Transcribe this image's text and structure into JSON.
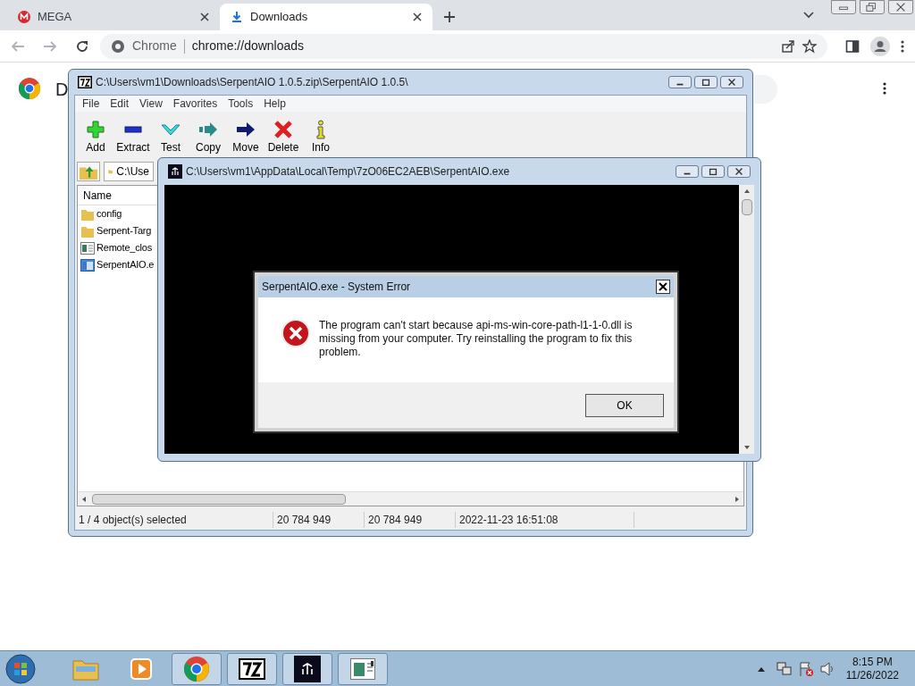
{
  "browser": {
    "tabs": [
      {
        "title": "MEGA",
        "kind": "mega",
        "selected": false
      },
      {
        "title": "Downloads",
        "kind": "download",
        "selected": true
      }
    ],
    "omnibox": {
      "site_label": "Chrome",
      "url": "chrome://downloads"
    },
    "page": {
      "title": "D"
    }
  },
  "archive_window": {
    "title": "C:\\Users\\vm1\\Downloads\\SerpentAIO 1.0.5.zip\\SerpentAIO 1.0.5\\",
    "menu": [
      "File",
      "Edit",
      "View",
      "Favorites",
      "Tools",
      "Help"
    ],
    "toolbar": [
      {
        "label": "Add",
        "kind": "add"
      },
      {
        "label": "Extract",
        "kind": "extract"
      },
      {
        "label": "Test",
        "kind": "test"
      },
      {
        "label": "Copy",
        "kind": "copy"
      },
      {
        "label": "Move",
        "kind": "move"
      },
      {
        "label": "Delete",
        "kind": "delete"
      },
      {
        "label": "Info",
        "kind": "info"
      }
    ],
    "address": "C:\\Use",
    "columns": [
      "Name"
    ],
    "files": [
      {
        "name": "config",
        "kind": "folder"
      },
      {
        "name": "Serpent-Targ",
        "kind": "folder"
      },
      {
        "name": "Remote_clos",
        "kind": "file"
      },
      {
        "name": "SerpentAIO.e",
        "kind": "exe"
      }
    ],
    "status_bar": [
      "1 / 4 object(s) selected",
      "20 784 949",
      "20 784 949",
      "2022-11-23 16:51:08"
    ]
  },
  "console_window": {
    "title": "C:\\Users\\vm1\\AppData\\Local\\Temp\\7zO06EC2AEB\\SerpentAIO.exe"
  },
  "error_dialog": {
    "title": "SerpentAIO.exe - System Error",
    "message": "The program can't start because api-ms-win-core-path-l1-1-0.dll is missing from your computer. Try reinstalling the program to fix this problem.",
    "button": "OK"
  },
  "taskbar": {
    "apps": [
      {
        "kind": "folder",
        "running": false
      },
      {
        "kind": "media",
        "running": false
      },
      {
        "kind": "chrome",
        "running": true
      },
      {
        "kind": "sevenzip",
        "running": true
      },
      {
        "kind": "serpent",
        "running": true
      },
      {
        "kind": "window",
        "running": true
      }
    ],
    "time": "8:15 PM",
    "date": "11/26/2022"
  }
}
